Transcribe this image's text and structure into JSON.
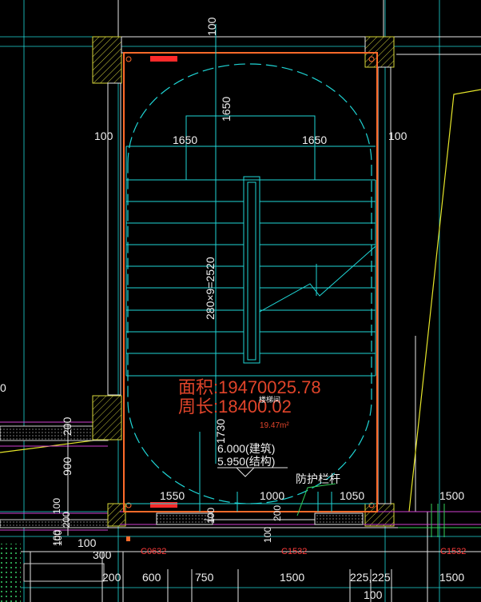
{
  "drawing": {
    "area_label": "面积:19470025.78",
    "perimeter_label": "周长:18400.02",
    "room_area": "19.47m²",
    "room_name": "楼梯间",
    "elevation_arch": "6.000(建筑)",
    "elevation_struct": "5.950(结构)",
    "railing_note": "防护栏杆",
    "stair_dim": "280×9=2520",
    "dims": {
      "top_100": "100",
      "left_100": "100",
      "right_100": "100",
      "landing_1650_v": "1650",
      "landing_1650_left": "1650",
      "landing_1650_right": "1650",
      "bottom_1730": "1730",
      "b_1550": "1550",
      "b_1000": "1000",
      "b_1050": "1050",
      "r_1500_a": "1500",
      "r_1500_b": "1500",
      "left_200": "200",
      "left_900": "900",
      "left_100a": "100",
      "left_200b": "200",
      "left_100b": "100",
      "bottom_100_a": "100",
      "bottom_100_b": "100",
      "bottom_100_c": "100",
      "bottom_200_mid": "200",
      "bottom_100_mid": "100",
      "row_300": "300",
      "row_200": "200",
      "row_600": "600",
      "row_750": "750",
      "row_1500": "1500",
      "row_225": "225,225",
      "row_1500b": "1500",
      "row_100": "100",
      "left_0": "0"
    },
    "refs": {
      "c0632": "C0632",
      "c1532a": "C1532",
      "c1532b": "C1532"
    }
  },
  "colors": {
    "background": "#000000",
    "wall": "#ff6a2a",
    "cyan": "#1fd6d6",
    "yellow": "#e6e62a",
    "magenta": "#d040d0",
    "green": "#34d05a",
    "red_text": "#e0442a"
  }
}
